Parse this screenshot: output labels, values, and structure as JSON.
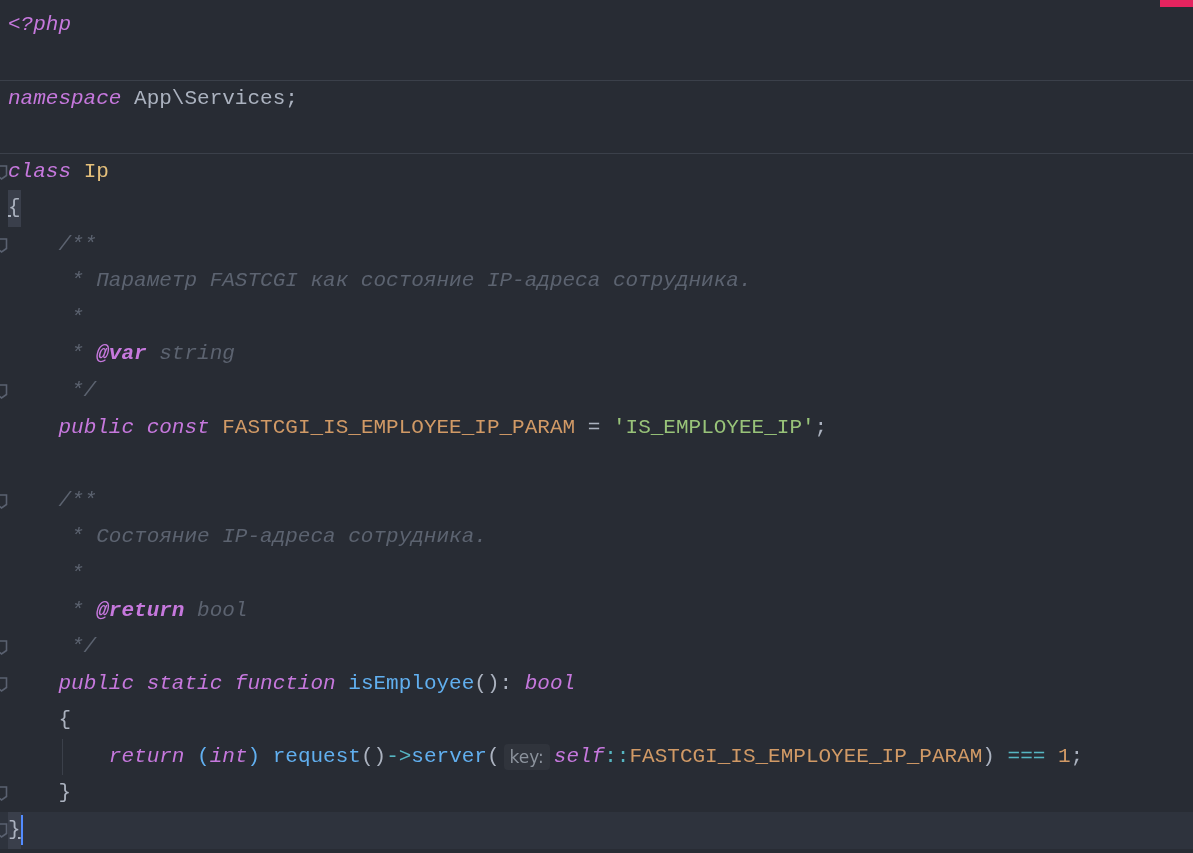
{
  "editor": {
    "error_marker": true,
    "lines": [
      {
        "fold": false,
        "separator_above": false,
        "indent_guide": false,
        "cursor": false,
        "tokens": [
          {
            "text": "<?php",
            "kind": "keyword"
          }
        ]
      },
      {
        "fold": false,
        "separator_above": false,
        "indent_guide": false,
        "cursor": false
      },
      {
        "fold": false,
        "separator_above": true,
        "indent_guide": false,
        "cursor": false,
        "tokens": [
          {
            "text": "namespace",
            "kind": "keyword"
          },
          {
            "text": " App\\Services;",
            "kind": "plain"
          }
        ]
      },
      {
        "fold": false,
        "separator_above": false,
        "indent_guide": false,
        "cursor": false
      },
      {
        "fold": true,
        "separator_above": true,
        "indent_guide": false,
        "cursor": false,
        "tokens": [
          {
            "text": "class",
            "kind": "keyword"
          },
          {
            "text": " Ip",
            "kind": "class"
          }
        ]
      },
      {
        "fold": false,
        "separator_above": false,
        "indent_guide": false,
        "cursor": false,
        "tokens": [
          {
            "text": "{",
            "kind": "brace_match"
          }
        ]
      },
      {
        "fold": true,
        "separator_above": false,
        "indent_guide": false,
        "cursor": false,
        "tokens": [
          {
            "text": "    /**",
            "kind": "comment"
          }
        ]
      },
      {
        "fold": false,
        "separator_above": false,
        "indent_guide": false,
        "cursor": false,
        "tokens": [
          {
            "text": "     * Параметр FASTCGI как состояние IP-адреса сотрудника.",
            "kind": "comment"
          }
        ]
      },
      {
        "fold": false,
        "separator_above": false,
        "indent_guide": false,
        "cursor": false,
        "tokens": [
          {
            "text": "     *",
            "kind": "comment"
          }
        ]
      },
      {
        "fold": false,
        "separator_above": false,
        "indent_guide": false,
        "cursor": false,
        "tokens": [
          {
            "text": "     * ",
            "kind": "comment"
          },
          {
            "text": "@var",
            "kind": "doctag"
          },
          {
            "text": " string",
            "kind": "comment"
          }
        ]
      },
      {
        "fold": true,
        "separator_above": false,
        "indent_guide": false,
        "cursor": false,
        "tokens": [
          {
            "text": "     */",
            "kind": "comment"
          }
        ]
      },
      {
        "fold": false,
        "separator_above": false,
        "indent_guide": false,
        "cursor": false,
        "tokens": [
          {
            "text": "    public const",
            "kind": "keyword"
          },
          {
            "text": " FASTCGI_IS_EMPLOYEE_IP_PARAM",
            "kind": "const"
          },
          {
            "text": " = ",
            "kind": "plain"
          },
          {
            "text": "'IS_EMPLOYEE_IP'",
            "kind": "string"
          },
          {
            "text": ";",
            "kind": "plain"
          }
        ]
      },
      {
        "fold": false,
        "separator_above": false,
        "indent_guide": false,
        "cursor": false
      },
      {
        "fold": true,
        "separator_above": false,
        "indent_guide": false,
        "cursor": false,
        "tokens": [
          {
            "text": "    /**",
            "kind": "comment"
          }
        ]
      },
      {
        "fold": false,
        "separator_above": false,
        "indent_guide": false,
        "cursor": false,
        "tokens": [
          {
            "text": "     * Состояние IP-адреса сотрудника.",
            "kind": "comment"
          }
        ]
      },
      {
        "fold": false,
        "separator_above": false,
        "indent_guide": false,
        "cursor": false,
        "tokens": [
          {
            "text": "     *",
            "kind": "comment"
          }
        ]
      },
      {
        "fold": false,
        "separator_above": false,
        "indent_guide": false,
        "cursor": false,
        "tokens": [
          {
            "text": "     * ",
            "kind": "comment"
          },
          {
            "text": "@return",
            "kind": "doctag"
          },
          {
            "text": " bool",
            "kind": "comment"
          }
        ]
      },
      {
        "fold": true,
        "separator_above": false,
        "indent_guide": false,
        "cursor": false,
        "tokens": [
          {
            "text": "     */",
            "kind": "comment"
          }
        ]
      },
      {
        "fold": true,
        "separator_above": false,
        "indent_guide": false,
        "cursor": false,
        "tokens": [
          {
            "text": "    public static function",
            "kind": "keyword"
          },
          {
            "text": " isEmployee",
            "kind": "func"
          },
          {
            "text": "():",
            "kind": "plain"
          },
          {
            "text": " bool",
            "kind": "keyword"
          }
        ]
      },
      {
        "fold": false,
        "separator_above": false,
        "indent_guide": false,
        "cursor": false,
        "tokens": [
          {
            "text": "    {",
            "kind": "plain"
          }
        ]
      },
      {
        "fold": false,
        "separator_above": false,
        "indent_guide": true,
        "cursor": false,
        "tokens": [
          {
            "text": "        return",
            "kind": "keyword"
          },
          {
            "text": " (",
            "kind": "func"
          },
          {
            "text": "int",
            "kind": "keyword"
          },
          {
            "text": ")",
            "kind": "func"
          },
          {
            "text": " request",
            "kind": "func"
          },
          {
            "text": "()",
            "kind": "plain"
          },
          {
            "text": "->",
            "kind": "op"
          },
          {
            "text": "server",
            "kind": "func"
          },
          {
            "text": "(",
            "kind": "plain"
          },
          {
            "text": "key:",
            "kind": "hint"
          },
          {
            "text": "self",
            "kind": "keyword"
          },
          {
            "text": "::",
            "kind": "op"
          },
          {
            "text": "FASTCGI_IS_EMPLOYEE_IP_PARAM",
            "kind": "const"
          },
          {
            "text": ")",
            "kind": "plain"
          },
          {
            "text": " ===",
            "kind": "op"
          },
          {
            "text": " 1",
            "kind": "number"
          },
          {
            "text": ";",
            "kind": "plain"
          }
        ]
      },
      {
        "fold": true,
        "separator_above": false,
        "indent_guide": false,
        "cursor": false,
        "tokens": [
          {
            "text": "    }",
            "kind": "plain"
          }
        ]
      },
      {
        "fold": true,
        "separator_above": false,
        "indent_guide": false,
        "cursor": true,
        "tokens": [
          {
            "text": "}",
            "kind": "brace_match"
          }
        ]
      }
    ]
  }
}
